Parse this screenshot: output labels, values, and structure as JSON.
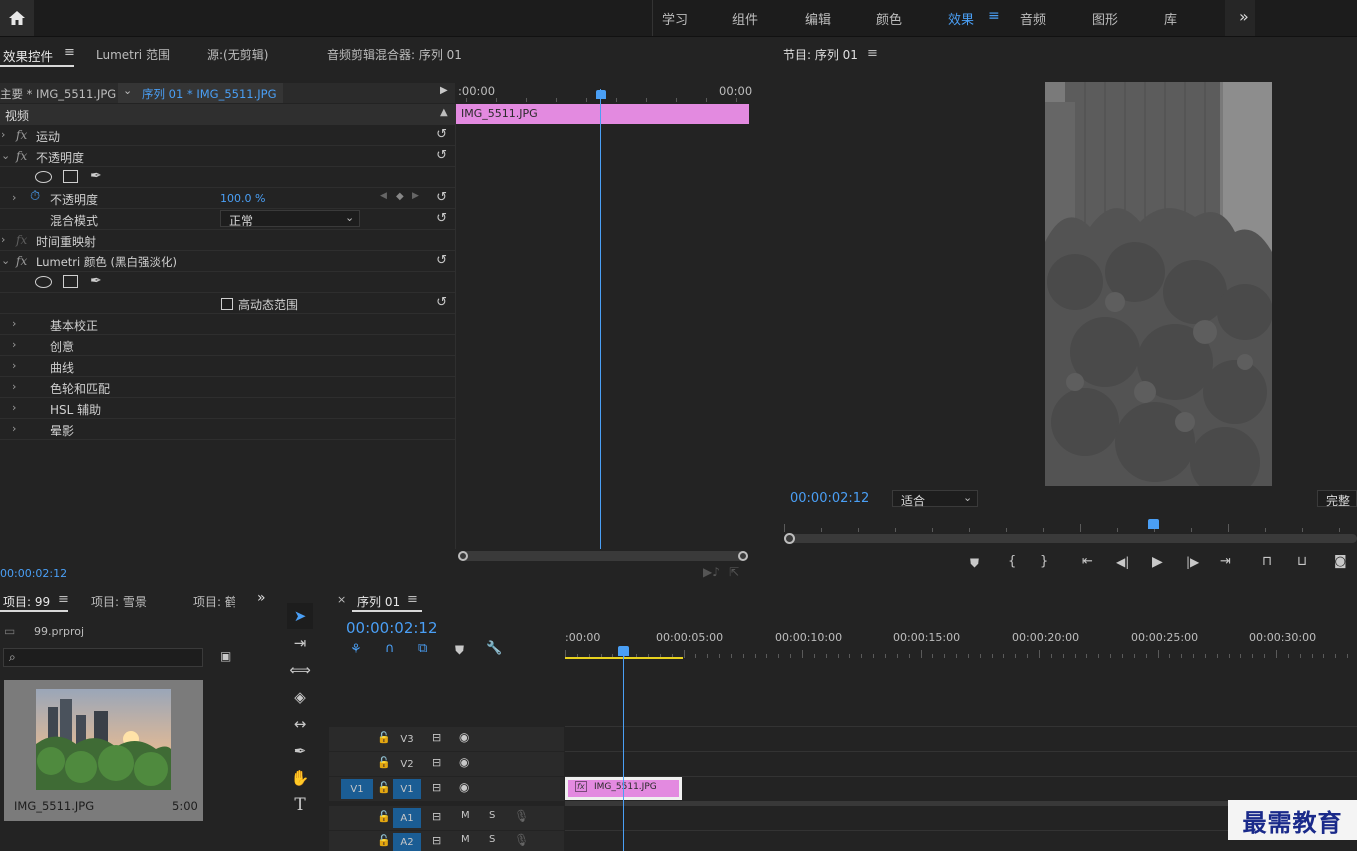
{
  "topbar": {
    "workspaces": [
      {
        "label": "学习"
      },
      {
        "label": "组件"
      },
      {
        "label": "编辑"
      },
      {
        "label": "颜色"
      },
      {
        "label": "效果",
        "active": true
      },
      {
        "label": "音频"
      },
      {
        "label": "图形"
      },
      {
        "label": "库"
      }
    ],
    "more": "»"
  },
  "effect_panel": {
    "tabs": [
      "效果控件",
      "Lumetri 范围",
      "源:(无剪辑)",
      "音频剪辑混合器: 序列 01"
    ],
    "master_clip": "主要 * IMG_5511.JPG",
    "sequence_clip": "序列 01 * IMG_5511.JPG",
    "section_video": "视频",
    "timeline_start": ":00:00",
    "timeline_end": "00:00",
    "clip_label": "IMG_5511.JPG",
    "rows": {
      "motion": "运动",
      "opacity": "不透明度",
      "opacity_param": "不透明度",
      "opacity_value": "100.0 %",
      "blend_mode": "混合模式",
      "blend_value": "正常",
      "time_remap": "时间重映射",
      "lumetri": "Lumetri 颜色 (黑白强淡化)",
      "hdr": "高动态范围",
      "basic": "基本校正",
      "creative": "创意",
      "curves": "曲线",
      "color_wheels": "色轮和匹配",
      "hsl": "HSL 辅助",
      "vignette": "晕影"
    },
    "timecode": "00:00:02:12"
  },
  "program_monitor": {
    "title": "节目: 序列 01",
    "timecode": "00:00:02:12",
    "zoom": "适合",
    "quality": "完整"
  },
  "project_panel": {
    "tabs": [
      "项目: 99",
      "项目: 雪景",
      "项目: 鹤"
    ],
    "file": "99.prproj",
    "search_placeholder": "",
    "thumb_name": "IMG_5511.JPG",
    "thumb_duration": "5:00"
  },
  "timeline": {
    "title": "序列 01",
    "timecode": "00:00:02:12",
    "ruler": [
      ":00:00",
      "00:00:05:00",
      "00:00:10:00",
      "00:00:15:00",
      "00:00:20:00",
      "00:00:25:00",
      "00:00:30:00"
    ],
    "tracks": {
      "v3": "V3",
      "v2": "V2",
      "v1": "V1",
      "v1_source": "V1",
      "a1": "A1",
      "a2": "A2",
      "m": "M",
      "s": "S"
    },
    "clip_label": "IMG_5511.JPG"
  },
  "watermark": "最需教育",
  "colors": {
    "accent": "#4a9ff5",
    "clip_pink": "#e38ae0",
    "panel_bg": "#232323"
  }
}
